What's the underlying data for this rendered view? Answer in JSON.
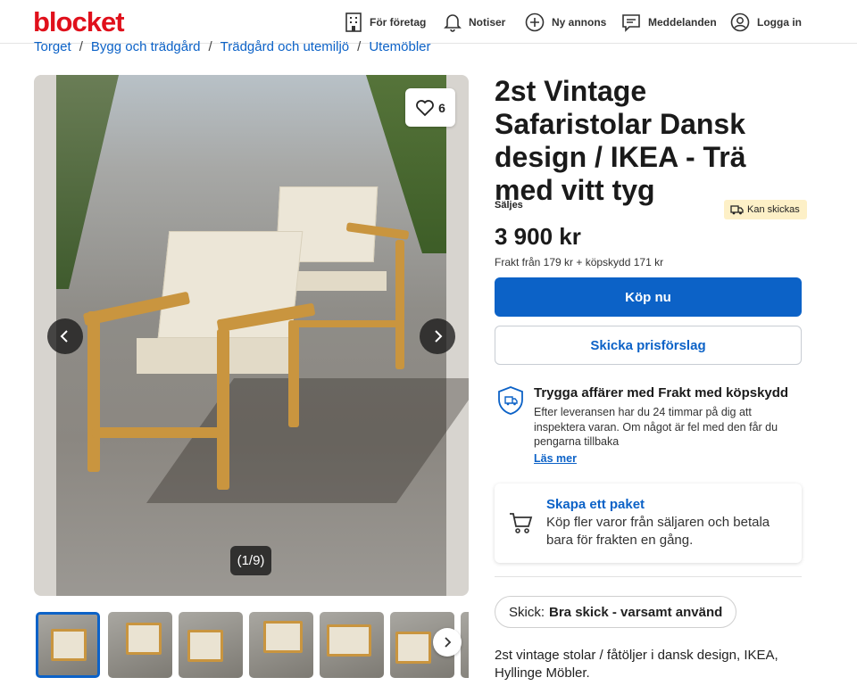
{
  "header": {
    "logo": "blocket",
    "nav": {
      "business": "För företag",
      "notices": "Notiser",
      "new_ad": "Ny annons",
      "messages": "Meddelanden",
      "login": "Logga in"
    }
  },
  "breadcrumb": [
    "Torget",
    "Bygg och trädgård",
    "Trädgård och utemiljö",
    "Utemöbler"
  ],
  "gallery": {
    "favorite_count": "6",
    "counter": "(1/9)",
    "thumbnail_count": 7
  },
  "listing": {
    "title": "2st Vintage Safaristolar Dansk design / IKEA - Trä med vitt tyg",
    "sale_type": "Säljes",
    "shipping_badge": "Kan skickas",
    "price": "3 900 kr",
    "shipping_info": "Frakt från 179 kr + köpskydd 171 kr",
    "buy_label": "Köp nu",
    "offer_label": "Skicka prisförslag"
  },
  "safe_trade": {
    "title": "Trygga affärer med Frakt med köpskydd",
    "text": "Efter leveransen har du 24 timmar på dig att inspektera varan. Om något är fel med den får du pengarna tillbaka",
    "link": "Läs mer"
  },
  "package": {
    "title": "Skapa ett paket",
    "text": "Köp fler varor från säljaren och betala bara för frakten en gång."
  },
  "condition": {
    "label": "Skick:",
    "value": "Bra skick - varsamt använd"
  },
  "description": "2st vintage stolar / fåtöljer i dansk design, IKEA, Hyllinge Möbler.",
  "colors": {
    "brand_red": "#e0101b",
    "accent_blue": "#0c62c7",
    "badge_yellow": "#fdf0c7"
  }
}
